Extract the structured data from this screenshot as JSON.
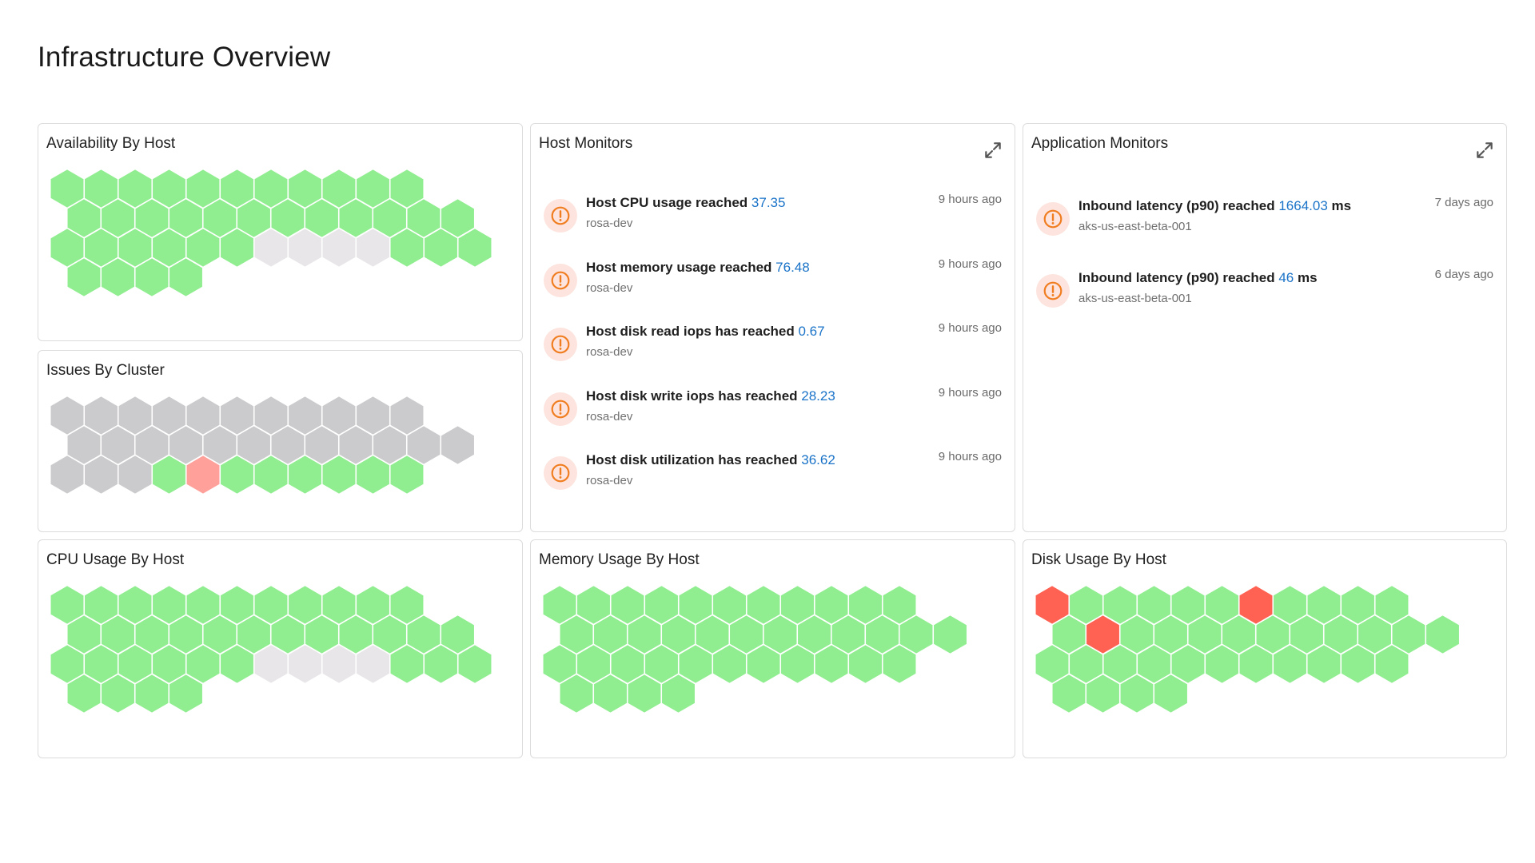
{
  "page": {
    "title": "Infrastructure Overview"
  },
  "colors": {
    "up": "#90ee90",
    "na": "#e8e6e8",
    "gray": "#cbcacc",
    "warn": "#ffa09a",
    "crit": "#ff6252",
    "accent": "#1a73c8",
    "alert": "#f07d1f"
  },
  "panels": {
    "availability": {
      "title": "Availability By Host",
      "rows": [
        "ggggggggggg",
        "gggggggggggg",
        "ggggggnnnnggg",
        "gggg"
      ]
    },
    "issues": {
      "title": "Issues By Cluster",
      "rows": [
        "xxxxxxxxxxx",
        "xxxxxxxxxxxx",
        "xxxgwgggggg"
      ]
    },
    "cpu": {
      "title": "CPU Usage By Host",
      "rows": [
        "ggggggggggg",
        "gggggggggggg",
        "ggggggnnnnggg",
        "gggg"
      ]
    },
    "memory": {
      "title": "Memory Usage By Host",
      "rows": [
        "ggggggggggg",
        "gggggggggggg",
        "ggggggggggg",
        "gggg"
      ]
    },
    "disk": {
      "title": "Disk Usage By Host",
      "rows": [
        "rgggggrgggg",
        "grgggggggggg",
        "ggggggggggg",
        "gggg"
      ]
    }
  },
  "host_monitors": {
    "title": "Host Monitors",
    "expand_icon": "expand-icon",
    "alerts": [
      {
        "title": "Host CPU usage reached",
        "value": "37.35",
        "unit": "",
        "host": "rosa-dev",
        "time": "9 hours ago"
      },
      {
        "title": "Host memory usage reached",
        "value": "76.48",
        "unit": "",
        "host": "rosa-dev",
        "time": "9 hours ago"
      },
      {
        "title": "Host disk read iops has reached",
        "value": "0.67",
        "unit": "",
        "host": "rosa-dev",
        "time": "9 hours ago"
      },
      {
        "title": "Host disk write iops has reached",
        "value": "28.23",
        "unit": "",
        "host": "rosa-dev",
        "time": "9 hours ago"
      },
      {
        "title": "Host disk utilization has reached",
        "value": "36.62",
        "unit": "",
        "host": "rosa-dev",
        "time": "9 hours ago"
      }
    ]
  },
  "application_monitors": {
    "title": "Application Monitors",
    "expand_icon": "expand-icon",
    "alerts": [
      {
        "title": "Inbound latency (p90) reached",
        "value": "1664.03",
        "unit": " ms",
        "host": "aks-us-east-beta-001",
        "time": "7 days ago"
      },
      {
        "title": "Inbound latency (p90) reached",
        "value": "46",
        "unit": " ms",
        "host": "aks-us-east-beta-001",
        "time": "6 days ago"
      }
    ]
  }
}
